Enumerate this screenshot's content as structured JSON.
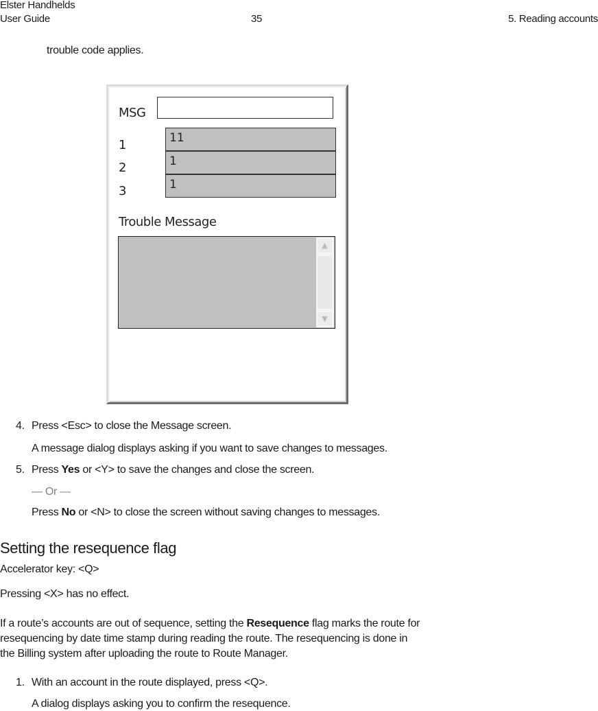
{
  "header": {
    "product": "Elster Handhelds",
    "doc_title": "User Guide",
    "page_number": "35",
    "chapter": "5. Reading accounts"
  },
  "intro_tail": "trouble code applies.",
  "device_screen": {
    "msg_label": "MSG",
    "msg_value": "",
    "rows": [
      {
        "label": "1",
        "value": "11"
      },
      {
        "label": "2",
        "value": "1"
      },
      {
        "label": "3",
        "value": "1"
      }
    ],
    "trouble_label": "Trouble Message",
    "trouble_value": "",
    "scroll_up_icon": "▲",
    "scroll_down_icon": "▼"
  },
  "steps_a": {
    "step4_num": "4.",
    "step4_text": "Press <Esc> to close the Message screen.",
    "step4_result": "A message dialog displays asking if you want to save changes to messages.",
    "step5_num": "5.",
    "step5_pre": "Press ",
    "step5_bold": "Yes",
    "step5_post": " or <Y> to save the changes and close the screen.",
    "or_text": "— Or —",
    "alt_pre": "Press ",
    "alt_bold": "No",
    "alt_post": " or <N> to close the screen without saving changes to messages."
  },
  "section": {
    "title": "Setting the resequence flag",
    "accelerator": "Accelerator key: <Q>",
    "x_note": "Pressing <X> has no effect.",
    "para_pre": "If a route’s accounts are out of sequence, setting the ",
    "para_bold": "Resequence",
    "para_line1_post": " flag marks the route for",
    "para_line2": "resequencing by date time stamp during reading the route. The resequencing is done in",
    "para_line3": "the Billing system after uploading the route to Route Manager.",
    "step1_num": "1.",
    "step1_text": "With an account in the route displayed, press <Q>.",
    "step1_result": "A dialog displays asking you to confirm the resequence."
  }
}
